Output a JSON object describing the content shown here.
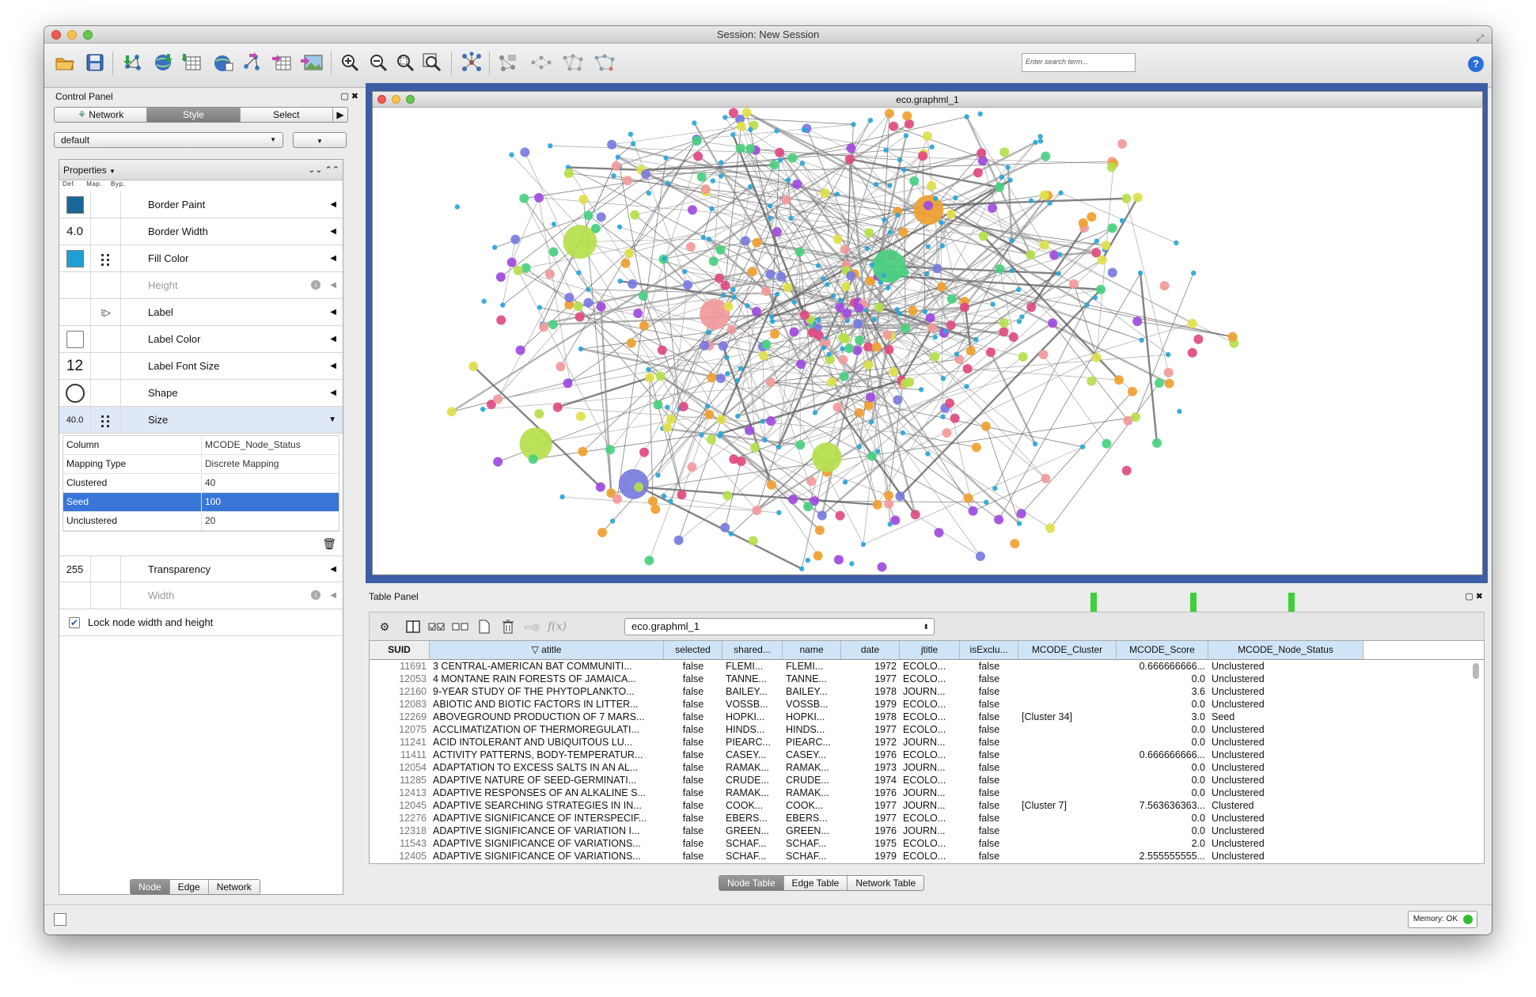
{
  "window": {
    "title": "Session: New Session"
  },
  "toolbar": {
    "search_placeholder": "Enter search term...",
    "help_label": "?",
    "buttons": [
      "open-session-icon",
      "save-session-icon",
      "import-network-file-icon",
      "import-network-url-icon",
      "import-table-icon",
      "export-network-icon",
      "export-network-url-icon",
      "export-table-icon",
      "export-image-icon",
      "zoom-in-icon",
      "zoom-out-icon",
      "zoom-fit-icon",
      "zoom-selected-icon",
      "apply-layout-icon",
      "first-neighbors-icon",
      "hide-selected-icon",
      "show-all-icon",
      "new-network-from-selection-icon"
    ]
  },
  "control_panel": {
    "title": "Control Panel",
    "tabs": [
      "Network",
      "Style",
      "Select"
    ],
    "active_tab": "Style",
    "style_selector": "default",
    "properties_label": "Properties",
    "col_headers": [
      "Def.",
      "Map.",
      "Byp."
    ],
    "properties": [
      {
        "label": "Border Paint",
        "def": "",
        "def_color": "#1a6696",
        "mapped": false,
        "dim": false
      },
      {
        "label": "Border Width",
        "def": "4.0",
        "def_color": "",
        "mapped": false,
        "dim": false
      },
      {
        "label": "Fill Color",
        "def": "",
        "def_color": "#1ea0d6",
        "mapped": true,
        "dim": false
      },
      {
        "label": "Height",
        "def": "",
        "def_color": "",
        "mapped": false,
        "dim": true
      },
      {
        "label": "Label",
        "def": "",
        "def_color": "",
        "mapped": "passthrough",
        "dim": false
      },
      {
        "label": "Label Color",
        "def": "",
        "def_color": "#ffffff",
        "mapped": false,
        "dim": false
      },
      {
        "label": "Label Font Size",
        "def": "12",
        "def_color": "",
        "mapped": false,
        "dim": false
      },
      {
        "label": "Shape",
        "def": "circle",
        "def_color": "",
        "mapped": false,
        "dim": false
      },
      {
        "label": "Size",
        "def": "40.0",
        "def_color": "",
        "mapped": true,
        "dim": false,
        "expanded": true
      }
    ],
    "size_mapping": [
      {
        "key": "Column",
        "value": "MCODE_Node_Status"
      },
      {
        "key": "Mapping Type",
        "value": "Discrete Mapping"
      },
      {
        "key": "Clustered",
        "value": "40"
      },
      {
        "key": "Seed",
        "value": "100",
        "selected": true
      },
      {
        "key": "Unclustered",
        "value": "20"
      }
    ],
    "properties_after": [
      {
        "label": "Transparency",
        "def": "255",
        "dim": false
      },
      {
        "label": "Width",
        "def": "",
        "dim": true
      }
    ],
    "lock_label": "Lock node width and height",
    "lock_checked": true,
    "bottom_tabs": [
      "Node",
      "Edge",
      "Network"
    ],
    "bottom_active": "Node"
  },
  "network_view": {
    "title": "eco.graphml_1"
  },
  "table_panel": {
    "title": "Table Panel",
    "selector": "eco.graphml_1",
    "fx_label": "f(x)",
    "columns": [
      "SUID",
      "▽ atitle",
      "selected",
      "shared...",
      "name",
      "date",
      "jtitle",
      "isExclu...",
      "MCODE_Cluster",
      "MCODE_Score",
      "MCODE_Node_Status"
    ],
    "rows": [
      [
        "11691",
        "3 CENTRAL-AMERICAN BAT COMMUNITI...",
        "false",
        "FLEMI...",
        "FLEMI...",
        "1972",
        "ECOLO...",
        "false",
        "",
        "0.666666666...",
        "Unclustered"
      ],
      [
        "12053",
        "4 MONTANE RAIN FORESTS OF JAMAICA...",
        "false",
        "TANNE...",
        "TANNE...",
        "1977",
        "ECOLO...",
        "false",
        "",
        "0.0",
        "Unclustered"
      ],
      [
        "12160",
        "9-YEAR STUDY OF THE PHYTOPLANKTO...",
        "false",
        "BAILEY...",
        "BAILEY...",
        "1978",
        "JOURN...",
        "false",
        "",
        "3.6",
        "Unclustered"
      ],
      [
        "12083",
        "ABIOTIC AND BIOTIC FACTORS IN LITTER...",
        "false",
        "VOSSB...",
        "VOSSB...",
        "1979",
        "ECOLO...",
        "false",
        "",
        "0.0",
        "Unclustered"
      ],
      [
        "12269",
        "ABOVEGROUND PRODUCTION OF 7 MARS...",
        "false",
        "HOPKI...",
        "HOPKI...",
        "1978",
        "ECOLO...",
        "false",
        "[Cluster 34]",
        "3.0",
        "Seed"
      ],
      [
        "12075",
        "ACCLIMATIZATION OF THERMOREGULATI...",
        "false",
        "HINDS...",
        "HINDS...",
        "1977",
        "ECOLO...",
        "false",
        "",
        "0.0",
        "Unclustered"
      ],
      [
        "11241",
        "ACID INTOLERANT AND UBIQUITOUS LU...",
        "false",
        "PIEARC...",
        "PIEARC...",
        "1972",
        "JOURN...",
        "false",
        "",
        "0.0",
        "Unclustered"
      ],
      [
        "11411",
        "ACTIVITY PATTERNS, BODY-TEMPERATUR...",
        "false",
        "CASEY...",
        "CASEY...",
        "1976",
        "ECOLO...",
        "false",
        "",
        "0.666666666...",
        "Unclustered"
      ],
      [
        "12054",
        "ADAPTATION TO EXCESS SALTS IN AN AL...",
        "false",
        "RAMAK...",
        "RAMAK...",
        "1973",
        "JOURN...",
        "false",
        "",
        "0.0",
        "Unclustered"
      ],
      [
        "11285",
        "ADAPTIVE NATURE OF SEED-GERMINATI...",
        "false",
        "CRUDE...",
        "CRUDE...",
        "1974",
        "ECOLO...",
        "false",
        "",
        "0.0",
        "Unclustered"
      ],
      [
        "12413",
        "ADAPTIVE RESPONSES OF AN ALKALINE S...",
        "false",
        "RAMAK...",
        "RAMAK...",
        "1976",
        "JOURN...",
        "false",
        "",
        "0.0",
        "Unclustered"
      ],
      [
        "12045",
        "ADAPTIVE SEARCHING STRATEGIES IN IN...",
        "false",
        "COOK...",
        "COOK...",
        "1977",
        "JOURN...",
        "false",
        "[Cluster 7]",
        "7.563636363...",
        "Clustered"
      ],
      [
        "12276",
        "ADAPTIVE SIGNIFICANCE OF INTERSPECIF...",
        "false",
        "EBERS...",
        "EBERS...",
        "1977",
        "ECOLO...",
        "false",
        "",
        "0.0",
        "Unclustered"
      ],
      [
        "12318",
        "ADAPTIVE SIGNIFICANCE OF VARIATION I...",
        "false",
        "GREEN...",
        "GREEN...",
        "1976",
        "JOURN...",
        "false",
        "",
        "0.0",
        "Unclustered"
      ],
      [
        "11543",
        "ADAPTIVE SIGNIFICANCE OF VARIATIONS...",
        "false",
        "SCHAF...",
        "SCHAF...",
        "1975",
        "ECOLO...",
        "false",
        "",
        "2.0",
        "Unclustered"
      ],
      [
        "12405",
        "ADAPTIVE SIGNIFICANCE OF VARIATIONS...",
        "false",
        "SCHAF...",
        "SCHAF...",
        "1979",
        "ECOLO...",
        "false",
        "",
        "2.555555555...",
        "Unclustered"
      ]
    ],
    "bottom_tabs": [
      "Node Table",
      "Edge Table",
      "Network Table"
    ],
    "bottom_active": "Node Table"
  },
  "status": {
    "memory_label": "Memory: OK"
  }
}
